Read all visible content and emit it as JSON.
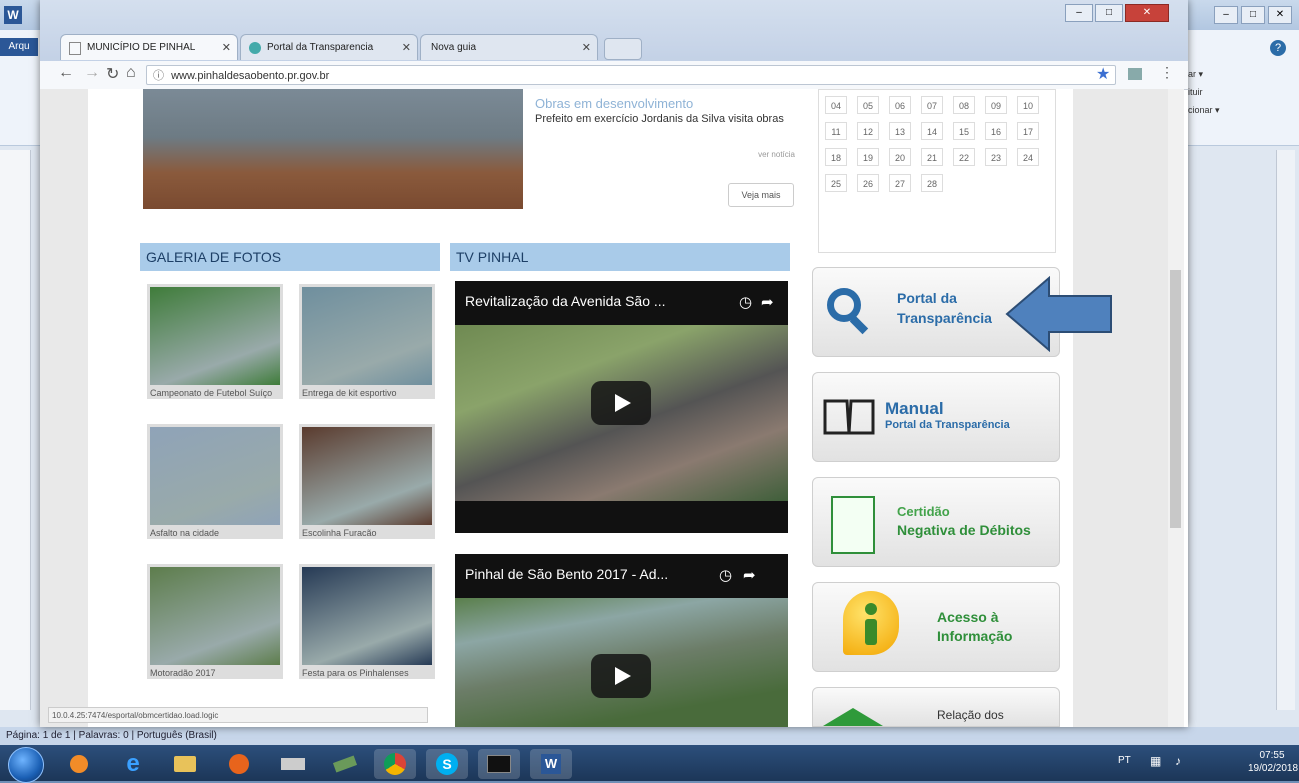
{
  "browser": {
    "url": "www.pinhaldesaobento.pr.gov.br",
    "tabs": [
      {
        "label": "MUNICÍPIO DE PINHAL"
      },
      {
        "label": "Portal da Transparencia"
      },
      {
        "label": "Nova guia"
      }
    ],
    "status_url": "10.0.4.25:7474/esportal/obmcertidao.load.logic"
  },
  "word": {
    "side_text": [
      "ar ▾",
      "ituir",
      "cionar ▾"
    ],
    "status": "Página: 1 de 1  |  Palavras: 0  |  Português (Brasil)"
  },
  "news": {
    "headline": "Obras em desenvolvimento",
    "body": "Prefeito em exercício Jordanis da Silva visita obras",
    "more_link": "ver notícia",
    "see_more": "Veja mais"
  },
  "gallery": {
    "title": "GALERIA DE FOTOS",
    "photos": [
      {
        "caption": "Campeonato de Futebol Suíço",
        "color": "#3f7c3a"
      },
      {
        "caption": "Entrega de kit esportivo",
        "color": "#6f8f9e"
      },
      {
        "caption": "Asfalto na cidade",
        "color": "#8fa3b8"
      },
      {
        "caption": "Escolinha Furacão",
        "color": "#5a3b2e"
      },
      {
        "caption": "Motoradão 2017",
        "color": "#5d7d4c"
      },
      {
        "caption": "Festa para os Pinhalenses",
        "color": "#263a55"
      }
    ]
  },
  "tv": {
    "title": "TV PINHAL",
    "videos": [
      {
        "title": "Revitalização da Avenida São ..."
      },
      {
        "title": "Pinhal de São Bento 2017 - Ad..."
      }
    ]
  },
  "calendar": {
    "rows": [
      [
        "04",
        "05",
        "06",
        "07",
        "08",
        "09",
        "10"
      ],
      [
        "11",
        "12",
        "13",
        "14",
        "15",
        "16",
        "17"
      ],
      [
        "18",
        "19",
        "20",
        "21",
        "22",
        "23",
        "24"
      ],
      [
        "25",
        "26",
        "27",
        "28"
      ]
    ]
  },
  "side_buttons": {
    "transparency": {
      "line1": "Portal da",
      "line2": "Transparência"
    },
    "manual": {
      "line1": "Manual",
      "line2": "Portal da Transparência"
    },
    "certidao": {
      "line1": "Certidão",
      "line2": "Negativa de Débitos"
    },
    "acesso": {
      "line1": "Acesso à",
      "line2": "Informação"
    },
    "relacao": {
      "line1": "Relação dos"
    }
  },
  "taskbar": {
    "clock_time": "07:55",
    "clock_date": "19/02/2018",
    "lang": "PT"
  },
  "colors": {
    "section_head": "#a9cbe9",
    "accent_blue": "#2b6ca8",
    "arrow": "#4f81bd",
    "certidao_green": "#2f8f3a"
  }
}
